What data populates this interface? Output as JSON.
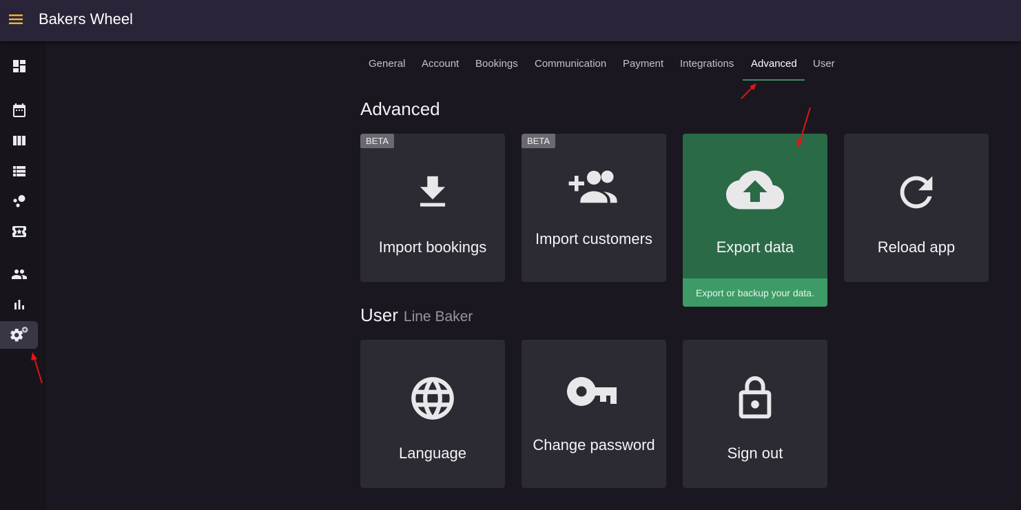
{
  "app": {
    "title": "Bakers Wheel"
  },
  "tabs": [
    {
      "label": "General"
    },
    {
      "label": "Account"
    },
    {
      "label": "Bookings"
    },
    {
      "label": "Communication"
    },
    {
      "label": "Payment"
    },
    {
      "label": "Integrations"
    },
    {
      "label": "Advanced"
    },
    {
      "label": "User"
    }
  ],
  "active_tab": "Advanced",
  "sidebar": {
    "items": [
      {
        "icon": "dashboard-icon"
      },
      {
        "icon": "calendar-icon"
      },
      {
        "icon": "columns-icon"
      },
      {
        "icon": "list-icon"
      },
      {
        "icon": "bubbles-icon"
      },
      {
        "icon": "ticket-star-icon"
      },
      {
        "icon": "people-icon"
      },
      {
        "icon": "bar-chart-icon"
      },
      {
        "icon": "settings-gear-icon"
      }
    ],
    "active": "settings-gear-icon"
  },
  "advanced": {
    "title": "Advanced",
    "cards": [
      {
        "label": "Import bookings",
        "badge": "BETA",
        "icon": "download-icon"
      },
      {
        "label": "Import customers",
        "badge": "BETA",
        "icon": "add-people-icon"
      },
      {
        "label": "Export data",
        "icon": "cloud-upload-icon",
        "hint": "Export or backup your data."
      },
      {
        "label": "Reload app",
        "icon": "reload-icon"
      }
    ]
  },
  "user": {
    "title": "User",
    "name": "Line Baker",
    "cards": [
      {
        "label": "Language",
        "icon": "globe-icon"
      },
      {
        "label": "Change password",
        "icon": "key-icon"
      },
      {
        "label": "Sign out",
        "icon": "lock-open-icon"
      }
    ]
  },
  "colors": {
    "topbar": "#2a2438",
    "background": "#1a1720",
    "card": "#2c2a33",
    "accent_green": "#2b6a46",
    "hint_green": "#3d9b68",
    "tab_underline": "#3f8c63",
    "menu_icon": "#f2b632",
    "annotation_arrow": "#e01515"
  }
}
